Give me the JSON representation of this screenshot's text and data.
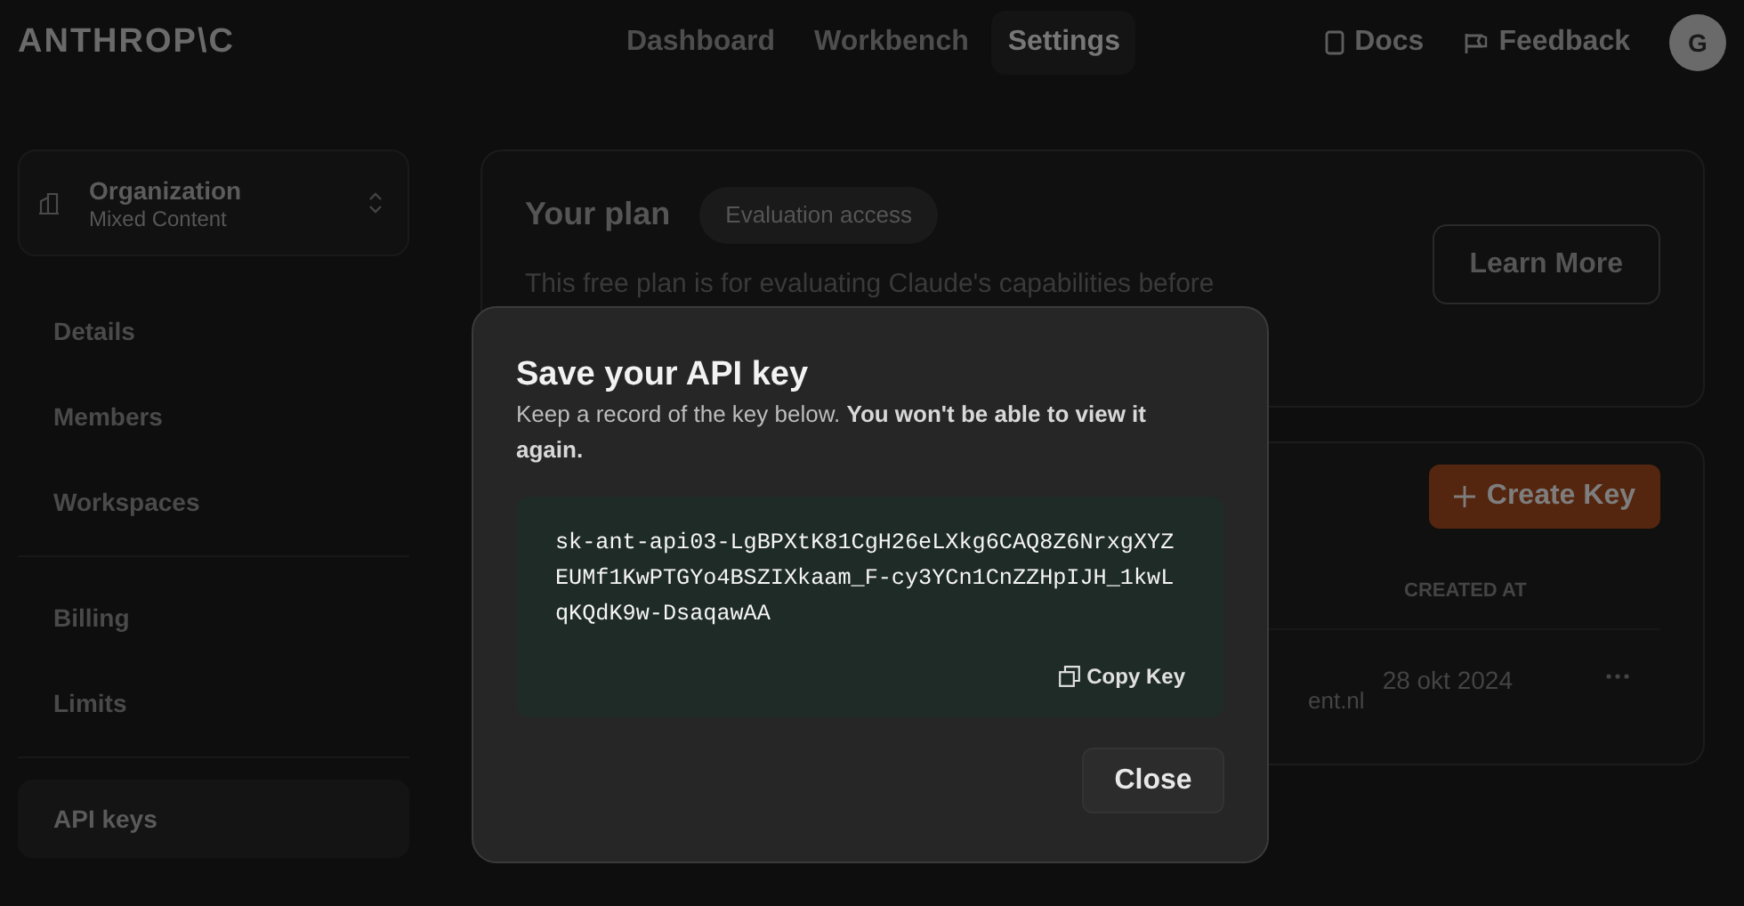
{
  "brand": "ANTHROP\\C",
  "nav": [
    {
      "label": "Dashboard",
      "selected": false
    },
    {
      "label": "Workbench",
      "selected": false
    },
    {
      "label": "Settings",
      "selected": true
    }
  ],
  "header_links": [
    {
      "label": "Docs",
      "kind": "book"
    },
    {
      "label": "Feedback",
      "kind": "flag"
    }
  ],
  "avatar": "G",
  "org": {
    "title": "Organization",
    "subtitle": "Mixed Content"
  },
  "sidebar": [
    [
      {
        "label": "Details",
        "selected": false
      },
      {
        "label": "Members",
        "selected": false
      },
      {
        "label": "Workspaces",
        "selected": false
      }
    ],
    [
      {
        "label": "Billing",
        "selected": false
      },
      {
        "label": "Limits",
        "selected": false
      }
    ],
    [
      {
        "label": "API keys",
        "selected": true
      }
    ]
  ],
  "plan": {
    "title": "Your plan",
    "badge": "Evaluation access",
    "description": "This free plan is for evaluating Claude's capabilities before",
    "button": "Learn More"
  },
  "keys": {
    "create_button": "Create Key",
    "columns": [
      "CREATED AT"
    ],
    "rows": [
      {
        "email": "ent.nl",
        "created": "28 okt 2024"
      }
    ]
  },
  "dialog": {
    "title": "Save your API key",
    "description": "Keep a record of the key below. **You won't be able to view it again.**",
    "key": "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",
    "copy_button": "Copy Key",
    "close_button": "Close"
  }
}
